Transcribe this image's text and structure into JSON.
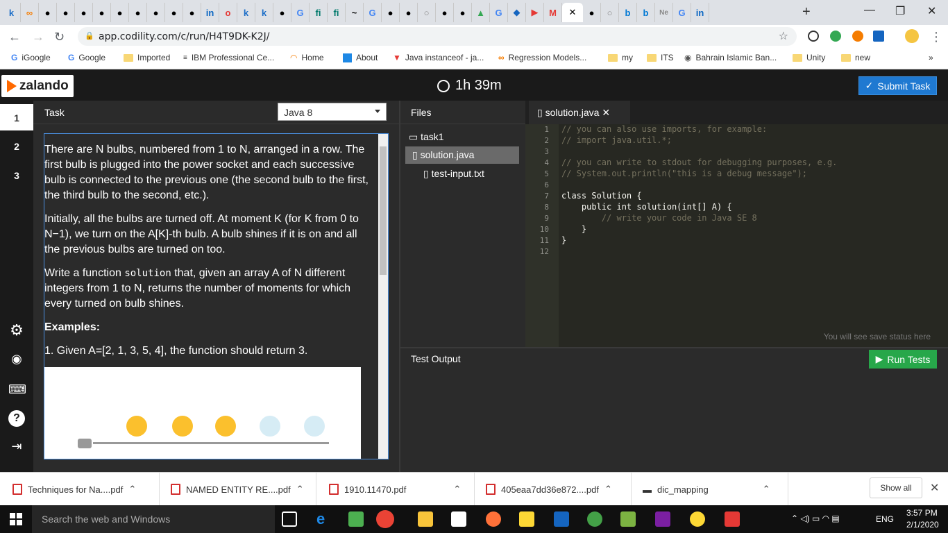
{
  "browser": {
    "url": "app.codility.com/c/run/H4T9DK-K2J/",
    "bookmarks": [
      {
        "label": "iGoogle",
        "icon": "google-g-icon"
      },
      {
        "label": "Google",
        "icon": "google-g-icon"
      },
      {
        "label": "Imported",
        "icon": "folder-icon"
      },
      {
        "label": "IBM Professional Ce...",
        "icon": "ibm-icon"
      },
      {
        "label": "Home",
        "icon": "coursera-icon"
      },
      {
        "label": "About",
        "icon": "edge-icon"
      },
      {
        "label": "Java instanceof - ja...",
        "icon": "vivaldi-icon"
      },
      {
        "label": "Regression Models...",
        "icon": "colab-icon"
      },
      {
        "label": "my",
        "icon": "folder-icon"
      },
      {
        "label": "ITS",
        "icon": "folder-icon"
      },
      {
        "label": "Bahrain Islamic Ban...",
        "icon": "globe-icon"
      },
      {
        "label": "Unity",
        "icon": "folder-icon"
      },
      {
        "label": "new",
        "icon": "folder-icon"
      }
    ],
    "more_bookmarks": "»"
  },
  "app": {
    "brand": "zalando",
    "timer": "1h 39m",
    "submit_label": "Submit Task",
    "nav_items": [
      "1",
      "2",
      "3"
    ],
    "task_header": "Task",
    "language": "Java 8",
    "task_paragraphs": [
      "There are N bulbs, numbered from 1 to N, arranged in a row. The first bulb is plugged into the power socket and each successive bulb is connected to the previous one (the second bulb to the first, the third bulb to the second, etc.).",
      "Initially, all the bulbs are turned off. At moment K (for K from 0 to N−1), we turn on the A[K]-th bulb. A bulb shines if it is on and all the previous bulbs are turned on too."
    ],
    "task_p3_before": "Write a function ",
    "task_p3_code": "solution",
    "task_p3_after": " that, given an array A of N different integers from 1 to N, returns the number of moments for which every turned on bulb shines.",
    "examples_heading": "Examples:",
    "example1": "1. Given A=[2, 1, 3, 5, 4], the function should return 3.",
    "files_header": "Files",
    "folder": "task1",
    "files": [
      "solution.java",
      "test-input.txt"
    ],
    "editor_tab": "solution.java",
    "code_lines": [
      "// you can also use imports, for example:",
      "// import java.util.*;",
      "",
      "// you can write to stdout for debugging purposes, e.g.",
      "// System.out.println(\"this is a debug message\");",
      "",
      "class Solution {",
      "    public int solution(int[] A) {",
      "        // write your code in Java SE 8",
      "    }",
      "}",
      ""
    ],
    "line_numbers": [
      "1",
      "2",
      "3",
      "4",
      "5",
      "6",
      "7",
      "8",
      "9",
      "10",
      "11",
      "12"
    ],
    "save_status": "You will see save status here",
    "test_output_label": "Test Output",
    "run_label": "Run Tests"
  },
  "downloads": {
    "items": [
      "Techniques for Na....pdf",
      "NAMED ENTITY RE....pdf",
      "1910.11470.pdf",
      "405eaa7dd36e872....pdf",
      "dic_mapping"
    ],
    "show_all": "Show all"
  },
  "taskbar": {
    "search_placeholder": "Search the web and Windows",
    "language": "ENG",
    "time": "3:57 PM",
    "date": "2/1/2020"
  }
}
